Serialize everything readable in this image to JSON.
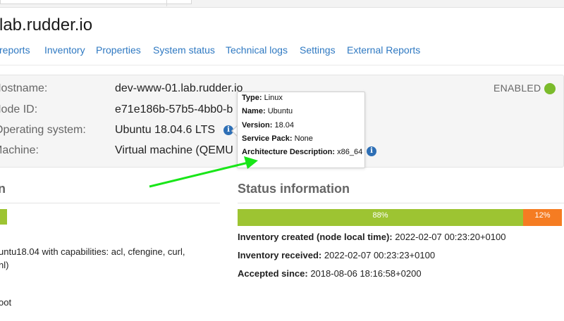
{
  "header": {
    "title": "lab.rudder.io"
  },
  "tabs": [
    {
      "label": "reports"
    },
    {
      "label": "Inventory"
    },
    {
      "label": "Properties"
    },
    {
      "label": "System status"
    },
    {
      "label": "Technical logs"
    },
    {
      "label": "Settings"
    },
    {
      "label": "External Reports"
    }
  ],
  "node_info": {
    "hostname_label": "Hostname:",
    "hostname_value": "dev-www-01.lab.rudder.io",
    "nodeid_label": "Node ID:",
    "nodeid_value": "e71e186b-57b5-4bb0-b",
    "os_label": "Operating system:",
    "os_value": "Ubuntu 18.04.6 LTS",
    "machine_label": "Machine:",
    "machine_value": "Virtual machine (QEMU",
    "status_text": "ENABLED",
    "status_color": "#7bbb2c",
    "info_icon": "info-icon"
  },
  "tooltip": {
    "type_label": "Type:",
    "type_value": "Linux",
    "name_label": "Name:",
    "name_value": "Ubuntu",
    "version_label": "Version:",
    "version_value": "18.04",
    "sp_label": "Service Pack:",
    "sp_value": "None",
    "arch_label": "Architecture Description:",
    "arch_value": "x86_64"
  },
  "left_section": {
    "title": "n",
    "line1": "untu18.04 with capabilities: acl, cfengine, curl,",
    "line2": "nl)",
    "line3": "oot"
  },
  "status": {
    "title": "Status information",
    "ok_percent": 88,
    "ok_label": "88%",
    "err_percent": 12,
    "err_label": "12%",
    "ok_color": "#9dc432",
    "err_color": "#f57c22",
    "inventory_created_label": "Inventory created (node local time):",
    "inventory_created_value": "2022-02-07 00:23:20+0100",
    "inventory_received_label": "Inventory received:",
    "inventory_received_value": "2022-02-07 00:23:23+0100",
    "accepted_since_label": "Accepted since:",
    "accepted_since_value": "2018-08-06 18:16:58+0200"
  },
  "annotation": {
    "arrow_color": "#19e619"
  }
}
